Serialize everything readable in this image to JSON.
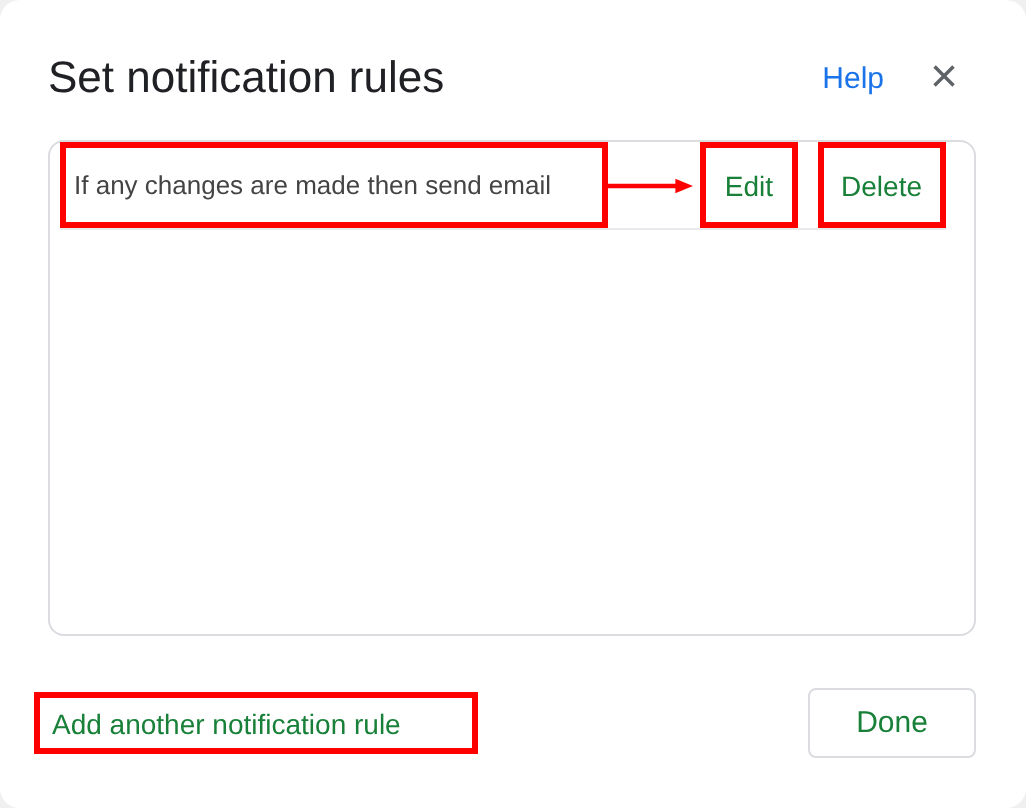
{
  "dialog": {
    "title": "Set notification rules",
    "help": "Help",
    "close": "×"
  },
  "rules": [
    {
      "text": "If any changes are made then send email",
      "highlighted": true,
      "arrow": true,
      "actions": [
        {
          "label": "Edit",
          "highlighted": true
        },
        {
          "label": "Delete",
          "highlighted": true
        }
      ]
    }
  ],
  "add_rule": {
    "label": "Add another notification rule",
    "highlighted": true
  },
  "buttons": [
    {
      "label": "Done"
    }
  ]
}
